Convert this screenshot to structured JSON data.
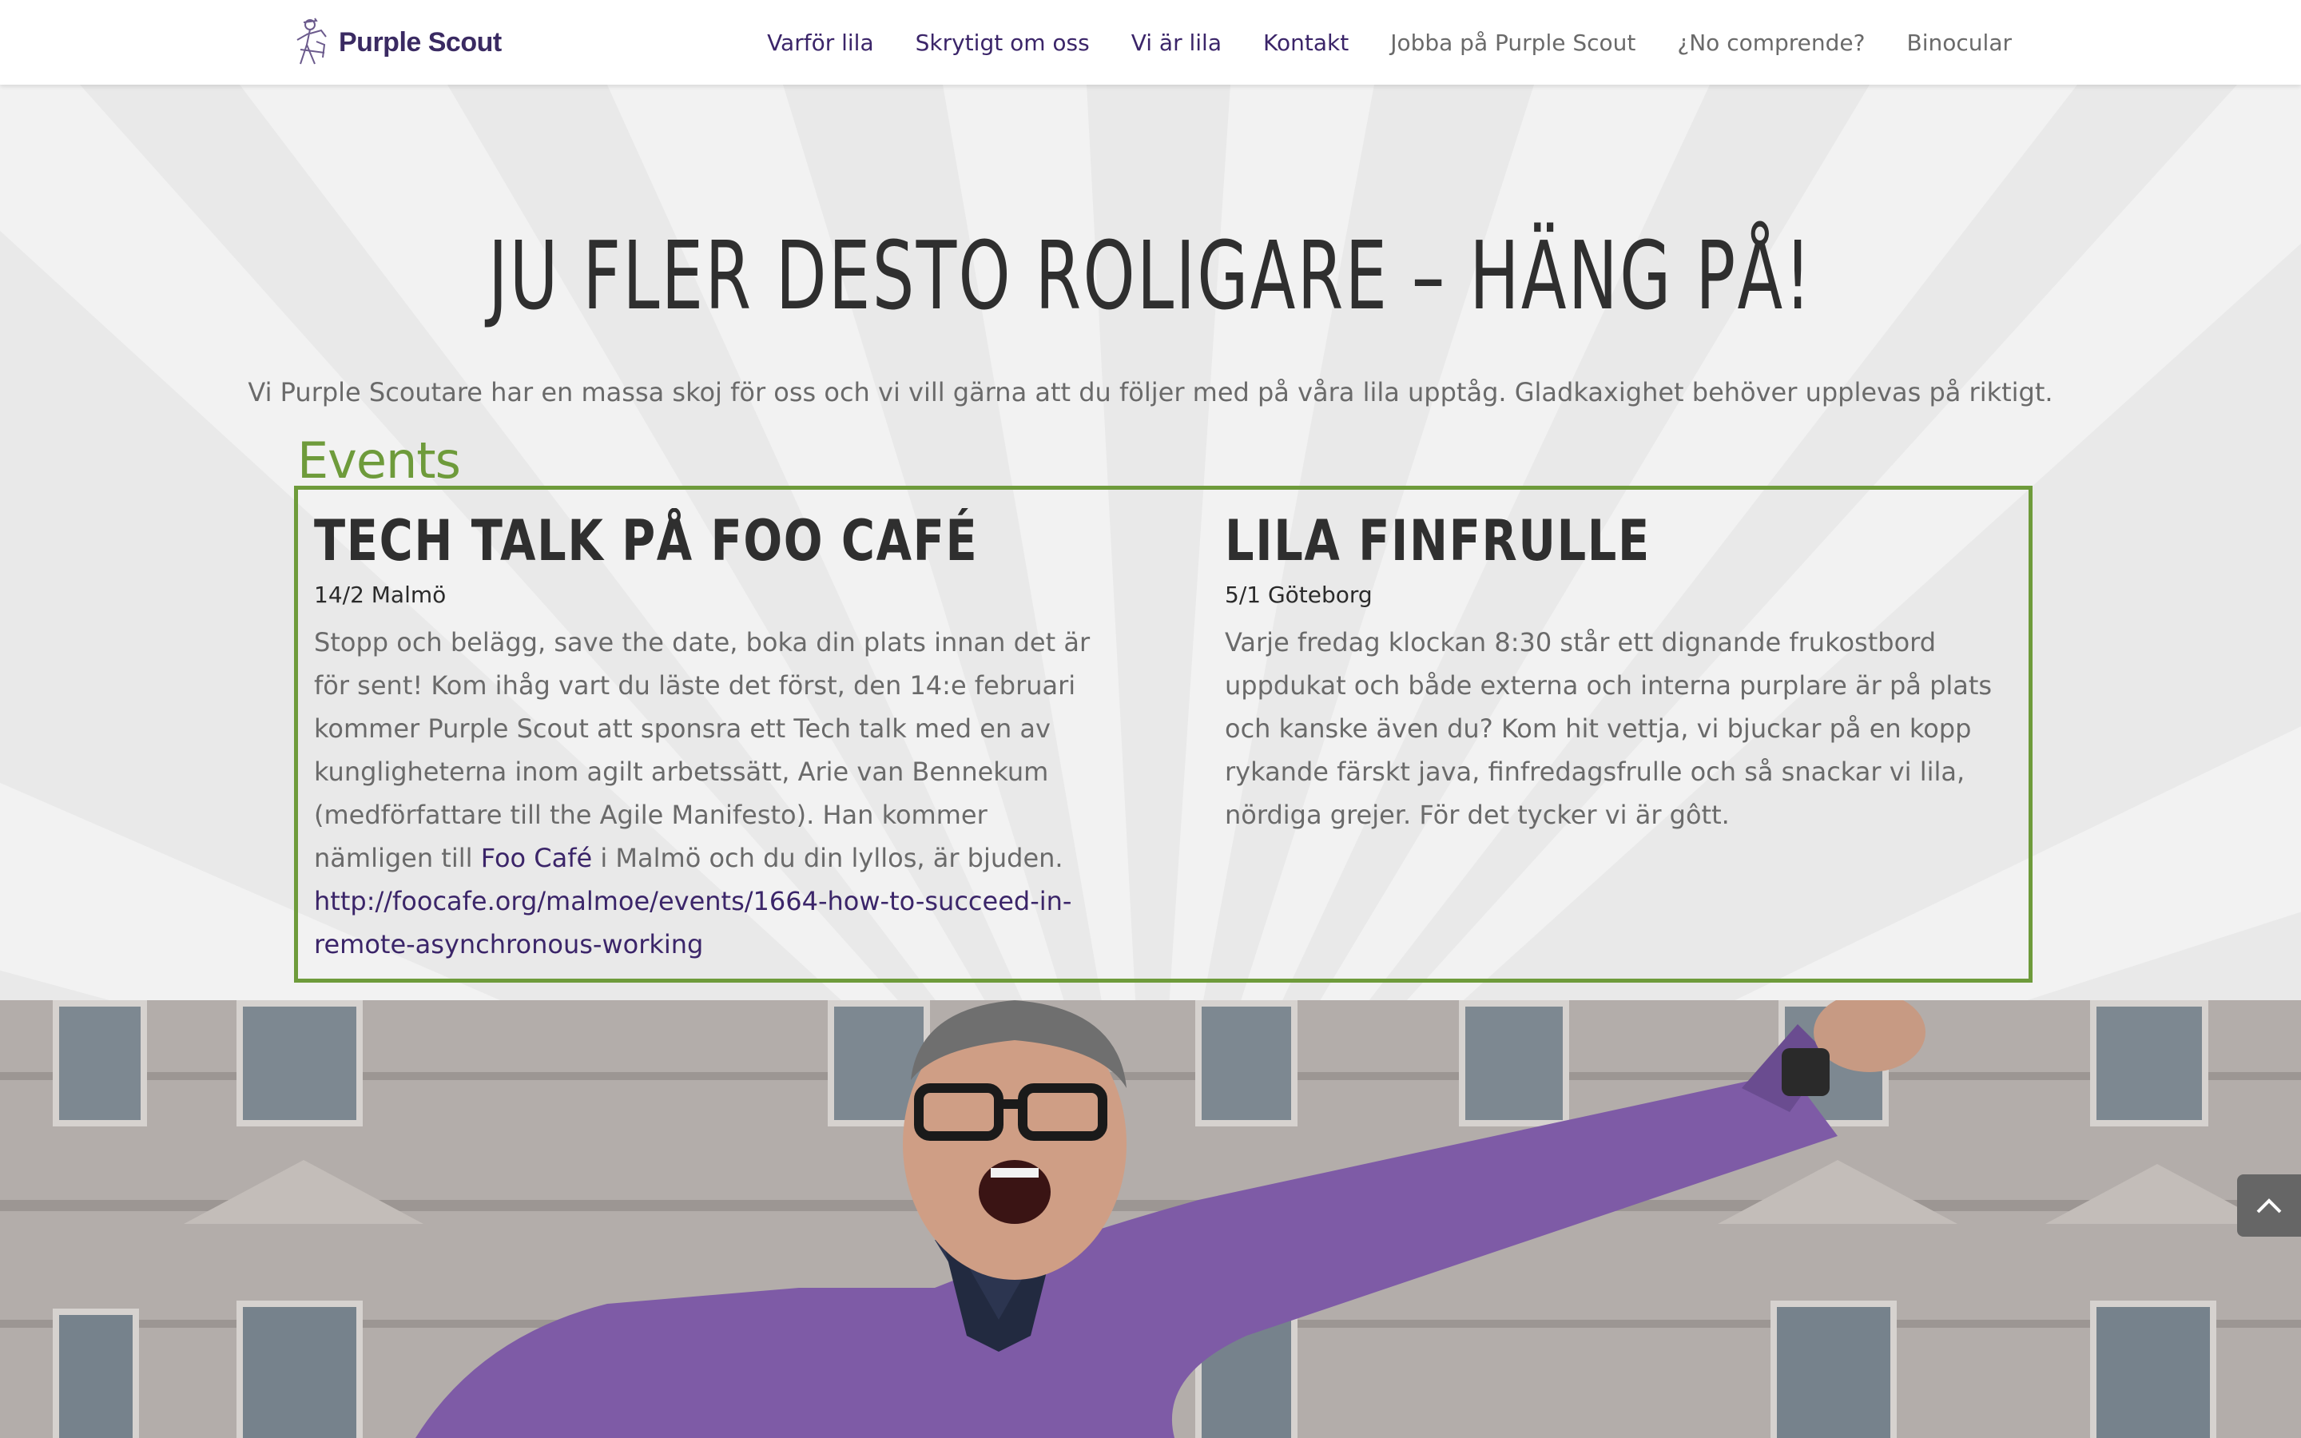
{
  "header": {
    "logo_text": "Purple Scout",
    "nav": [
      {
        "label": "Varför lila",
        "style": "purple"
      },
      {
        "label": "Skrytigt om oss",
        "style": "purple"
      },
      {
        "label": "Vi är lila",
        "style": "purple"
      },
      {
        "label": "Kontakt",
        "style": "purple"
      },
      {
        "label": "Jobba på Purple Scout",
        "style": "grey"
      },
      {
        "label": "¿No comprende?",
        "style": "grey"
      },
      {
        "label": "Binocular",
        "style": "grey"
      }
    ]
  },
  "hero": {
    "headline": "JU FLER DESTO ROLIGARE –   HÄNG PÅ!",
    "intro": "Vi Purple Scoutare har en massa skoj för oss och vi vill gärna att du följer med på våra lila upptåg. Gladkaxighet behöver upplevas på riktigt.",
    "events_title": "Events"
  },
  "events": [
    {
      "title": "TECH TALK PÅ FOO CAFÉ",
      "date": "14/2 Malmö",
      "body_before_link": "Stopp och belägg, save the date, boka din plats innan det är för sent! Kom ihåg vart du läste det först, den 14:e februari kommer Purple Scout att sponsra ett Tech talk med en av kunglighetern​a inom agilt arbetssätt, Arie van Bennekum (medförfattare till the Agile Manifesto). Han kommer nämligen till ",
      "inline_link": "Foo Café",
      "body_after_link": " i Malmö och du din lyllos, är bjuden.",
      "url": "http://foocafe.org/malmoe/events/1664-how-to-succeed-in-remote-asynchronous-working"
    },
    {
      "title": "LILA FINFRULLE",
      "date": "5/1 Göteborg",
      "body": "Varje fredag klockan 8:30 står ett dignande frukostbord uppdukat och både externa och interna purplare är på plats och kanske även du? Kom hit vettja, vi bjuckar på en kopp rykande färskt java, finfredagsfrulle och så snackar vi lila, nördiga grejer. För det tycker vi är gôtt."
    }
  ],
  "colors": {
    "accent_green": "#6e9b3b",
    "brand_purple": "#3b2569",
    "sweater_purple": "#7e5ba6"
  },
  "icons": {
    "logo": "scout-figure-icon",
    "back_to_top": "chevron-up-icon"
  }
}
